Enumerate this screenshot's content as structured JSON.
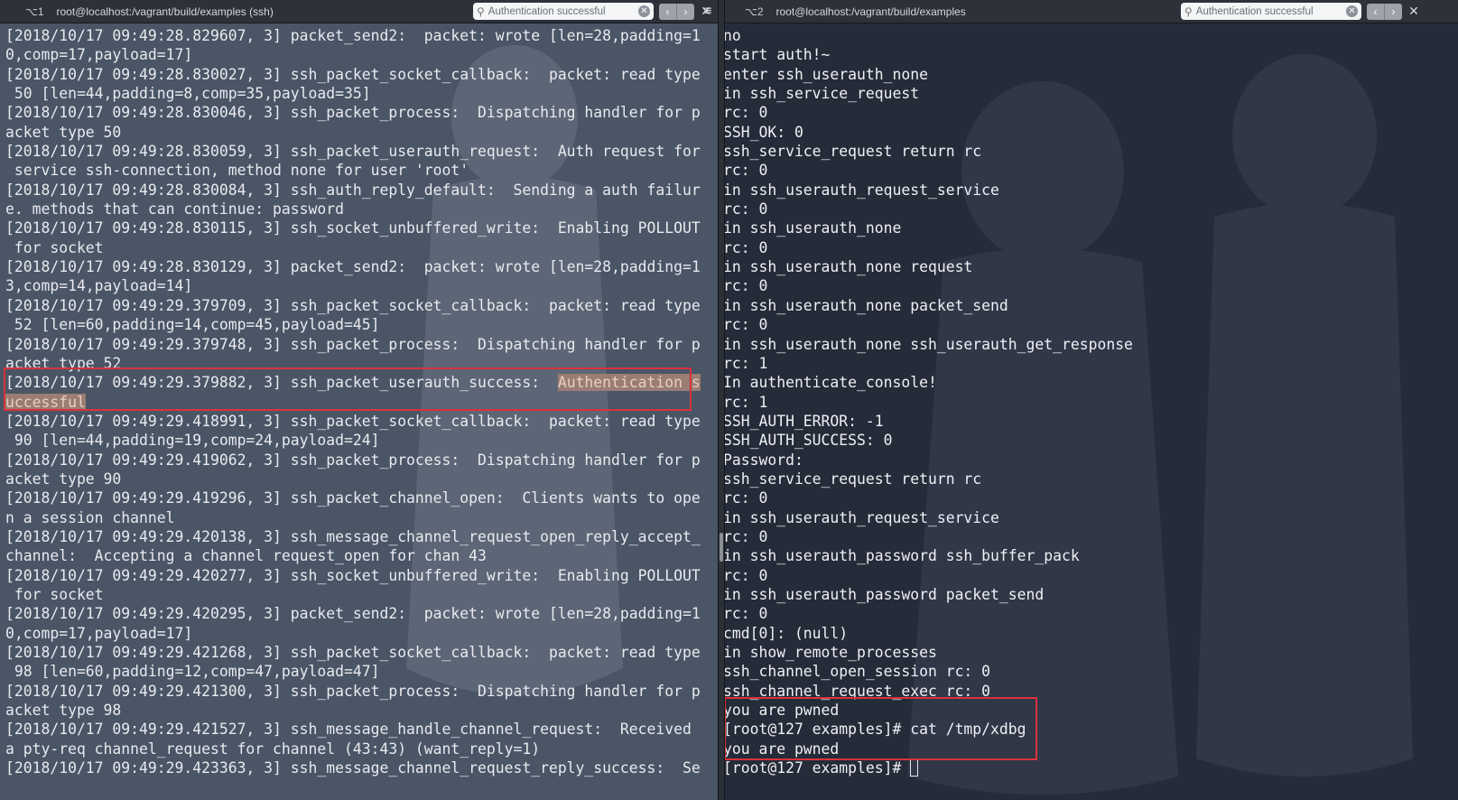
{
  "left": {
    "tab_key": "⌥1",
    "tab_title": "root@localhost:/vagrant/build/examples (ssh)",
    "search_value": "Authentication successful",
    "lines": [
      "[2018/10/17 09:49:28.829607, 3] packet_send2:  packet: wrote [len=28,padding=1",
      "0,comp=17,payload=17]",
      "[2018/10/17 09:49:28.830027, 3] ssh_packet_socket_callback:  packet: read type",
      " 50 [len=44,padding=8,comp=35,payload=35]",
      "[2018/10/17 09:49:28.830046, 3] ssh_packet_process:  Dispatching handler for p",
      "acket type 50",
      "[2018/10/17 09:49:28.830059, 3] ssh_packet_userauth_request:  Auth request for",
      " service ssh-connection, method none for user 'root'",
      "[2018/10/17 09:49:28.830084, 3] ssh_auth_reply_default:  Sending a auth failur",
      "e. methods that can continue: password",
      "[2018/10/17 09:49:28.830115, 3] ssh_socket_unbuffered_write:  Enabling POLLOUT",
      " for socket",
      "[2018/10/17 09:49:28.830129, 3] packet_send2:  packet: wrote [len=28,padding=1",
      "3,comp=14,payload=14]",
      "[2018/10/17 09:49:29.379709, 3] ssh_packet_socket_callback:  packet: read type",
      " 52 [len=60,padding=14,comp=45,payload=45]",
      "[2018/10/17 09:49:29.379748, 3] ssh_packet_process:  Dispatching handler for p",
      "acket type 52"
    ],
    "highlight_prefix": "[2018/10/17 09:49:29.379882, 3] ssh_packet_userauth_success:  ",
    "highlight_match1": "Authentication s",
    "highlight_match2": "uccessful",
    "lines_after": [
      "[2018/10/17 09:49:29.418991, 3] ssh_packet_socket_callback:  packet: read type",
      " 90 [len=44,padding=19,comp=24,payload=24]",
      "[2018/10/17 09:49:29.419062, 3] ssh_packet_process:  Dispatching handler for p",
      "acket type 90",
      "[2018/10/17 09:49:29.419296, 3] ssh_packet_channel_open:  Clients wants to ope",
      "n a session channel",
      "[2018/10/17 09:49:29.420138, 3] ssh_message_channel_request_open_reply_accept_",
      "channel:  Accepting a channel request_open for chan 43",
      "[2018/10/17 09:49:29.420277, 3] ssh_socket_unbuffered_write:  Enabling POLLOUT",
      " for socket",
      "[2018/10/17 09:49:29.420295, 3] packet_send2:  packet: wrote [len=28,padding=1",
      "0,comp=17,payload=17]",
      "[2018/10/17 09:49:29.421268, 3] ssh_packet_socket_callback:  packet: read type",
      " 98 [len=60,padding=12,comp=47,payload=47]",
      "[2018/10/17 09:49:29.421300, 3] ssh_packet_process:  Dispatching handler for p",
      "acket type 98",
      "[2018/10/17 09:49:29.421527, 3] ssh_message_handle_channel_request:  Received",
      "a pty-req channel_request for channel (43:43) (want_reply=1)",
      "[2018/10/17 09:49:29.423363, 3] ssh_message_channel_request_reply_success:  Se"
    ]
  },
  "right": {
    "tab_key": "⌥2",
    "tab_title": "root@localhost:/vagrant/build/examples",
    "search_value": "Authentication successful",
    "lines": [
      "no",
      "start auth!~",
      "enter ssh_userauth_none",
      "in ssh_service_request",
      "rc: 0",
      "SSH_OK: 0",
      "ssh_service_request return rc",
      "rc: 0",
      "in ssh_userauth_request_service",
      "rc: 0",
      "in ssh_userauth_none",
      "rc: 0",
      "in ssh_userauth_none request",
      "rc: 0",
      "in ssh_userauth_none packet_send",
      "rc: 0",
      "in ssh_userauth_none ssh_userauth_get_response",
      "rc: 1",
      "In authenticate_console!",
      "rc: 1",
      "SSH_AUTH_ERROR: -1",
      "SSH_AUTH_SUCCESS: 0",
      "Password:",
      "ssh_service_request return rc",
      "rc: 0",
      "in ssh_userauth_request_service",
      "rc: 0",
      "in ssh_userauth_password ssh_buffer_pack",
      "rc: 0",
      "in ssh_userauth_password packet_send",
      "rc: 0",
      "cmd[0]: (null)",
      "in show_remote_processes",
      "ssh_channel_open_session rc: 0",
      "ssh_channel_request_exec rc: 0"
    ],
    "boxed_lines": [
      "you are pwned",
      "[root@127 examples]# cat /tmp/xdbg",
      "you are pwned"
    ],
    "prompt": "[root@127 examples]# "
  },
  "icons": {
    "search": "magnifier-icon",
    "clear": "clear-search-icon",
    "prev": "chevron-left-icon",
    "next": "chevron-right-icon",
    "close": "close-icon",
    "menu": "hamburger-menu-icon"
  },
  "colors": {
    "highlight_box": "#d9323b",
    "left_bg": "#4a5566",
    "right_bg": "#252b38"
  }
}
